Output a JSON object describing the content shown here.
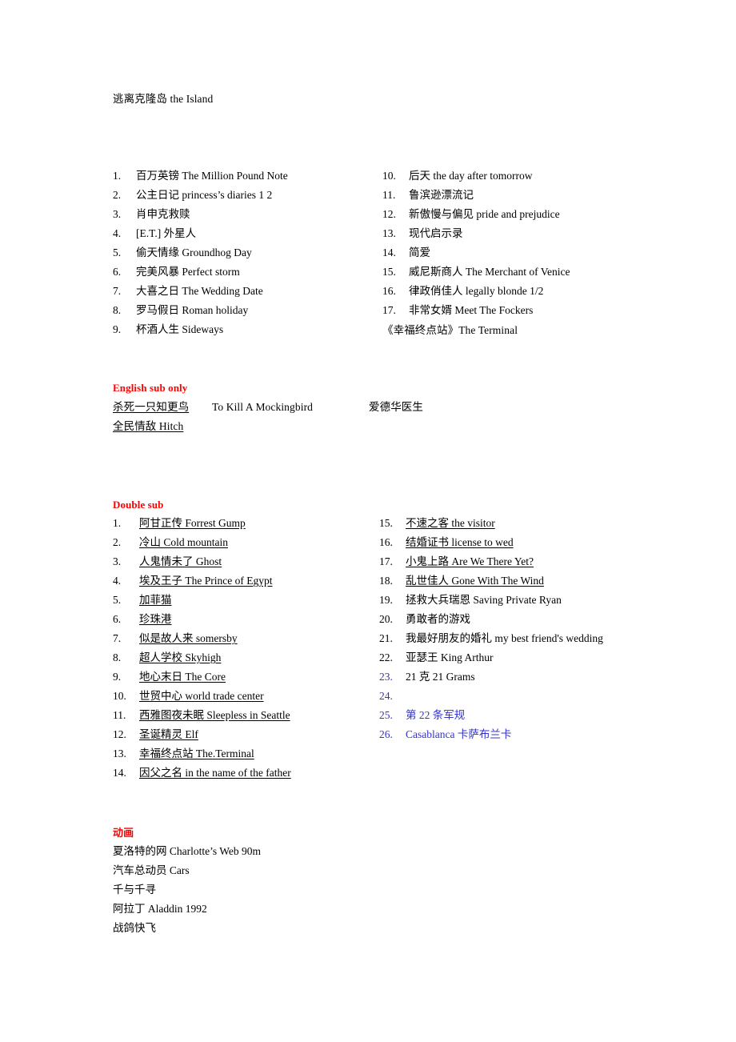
{
  "document": {
    "top_title": "逃离克隆岛  the Island"
  },
  "section_main": {
    "left_items": [
      {
        "num": "1.",
        "text": "百万英镑  The Million Pound Note"
      },
      {
        "num": "2.",
        "text": "公主日记 princess’s diaries 1 2"
      },
      {
        "num": "3.",
        "text": "肖申克救赎"
      },
      {
        "num": "4.",
        "text": "[E.T.]  外星人"
      },
      {
        "num": "5.",
        "text": "偷天情缘 Groundhog Day"
      },
      {
        "num": "6.",
        "text": "完美风暴  Perfect storm"
      },
      {
        "num": "7.",
        "text": "大喜之日 The Wedding Date"
      },
      {
        "num": "8.",
        "text": "罗马假日 Roman holiday"
      },
      {
        "num": "9.",
        "text": "杯酒人生     Sideways"
      }
    ],
    "right_items": [
      {
        "num": "10.",
        "text": "后天  the day after tomorrow"
      },
      {
        "num": "11.",
        "text": "鲁滨逊漂流记"
      },
      {
        "num": "12.",
        "text": "新傲慢与偏见 pride and prejudice"
      },
      {
        "num": "13.",
        "text": "现代启示录"
      },
      {
        "num": "14.",
        "text": "简爱"
      },
      {
        "num": "15.",
        "text": "威尼斯商人 The Merchant of Venice"
      },
      {
        "num": "16.",
        "text": "律政俏佳人  legally blonde 1/2"
      },
      {
        "num": "17.",
        "text": "非常女婿 Meet The Fockers"
      }
    ],
    "right_trailing": "《幸福终点站》The Terminal"
  },
  "section_english_sub": {
    "heading": "English sub only",
    "row1_col1": "杀死一只知更鸟",
    "row1_col2": "To Kill A Mockingbird",
    "row1_col3": "爱德华医生",
    "row2_col1": "全民情敌 Hitch"
  },
  "section_double_sub": {
    "heading": "Double sub",
    "left_items": [
      {
        "num": "1.",
        "text": "阿甘正传 Forrest Gump",
        "underline": true
      },
      {
        "num": "2.",
        "text": "冷山  Cold mountain",
        "underline": true
      },
      {
        "num": "3.",
        "text": "人鬼情未了 Ghost",
        "underline": true
      },
      {
        "num": "4.",
        "text": "埃及王子  The Prince of Egypt",
        "underline": true
      },
      {
        "num": "5.",
        "text": "加菲猫",
        "underline": true
      },
      {
        "num": "6.",
        "text": "珍珠港",
        "underline": true
      },
      {
        "num": "7.",
        "text": "似是故人来  somersby",
        "underline": true
      },
      {
        "num": "8.",
        "text": "超人学校 Skyhigh",
        "underline": true
      },
      {
        "num": "9.",
        "text": "地心末日  The Core",
        "underline": true
      },
      {
        "num": "10.",
        "text": "世贸中心 world trade center",
        "underline": true
      },
      {
        "num": "11.",
        "text": "西雅图夜未眠 Sleepless in Seattle ",
        "underline": true
      },
      {
        "num": "12.",
        "text": "圣诞精灵 Elf",
        "underline": true
      },
      {
        "num": "13.",
        "text": "幸福终点站 The.Terminal",
        "underline": true
      },
      {
        "num": "14.",
        "text": "因父之名 in the name of the father",
        "underline": true
      }
    ],
    "right_items": [
      {
        "num": "15.",
        "text": "不速之客 the visitor",
        "underline": true,
        "color": "black"
      },
      {
        "num": "16.",
        "text": "结婚证书 license to wed",
        "underline": true,
        "color": "black"
      },
      {
        "num": "17.",
        "text": "小鬼上路 Are We There Yet?",
        "underline": true,
        "color": "black"
      },
      {
        "num": "18.",
        "text": "乱世佳人 Gone With The Wind  ",
        "underline": true,
        "color": "black"
      },
      {
        "num": "19.",
        "text": "拯救大兵瑞恩 Saving Private Ryan",
        "underline": false,
        "color": "black"
      },
      {
        "num": "20.",
        "text": "勇敢者的游戏",
        "underline": false,
        "color": "black"
      },
      {
        "num": "21.",
        "text": "我最好朋友的婚礼 my best friend's wedding",
        "underline": false,
        "color": "black"
      },
      {
        "num": "22.",
        "text": "亚瑟王 King Arthur",
        "underline": false,
        "color": "black"
      },
      {
        "num": "23.",
        "text": "21 克  21 Grams",
        "underline": false,
        "color": "black",
        "num_color": "blue"
      },
      {
        "num": "24.",
        "text": "",
        "underline": false,
        "color": "blue",
        "num_color": "blue"
      },
      {
        "num": "25.",
        "text": "第 22 条军规",
        "underline": false,
        "color": "blue",
        "num_color": "blue"
      },
      {
        "num": "26.",
        "text": "Casablanca  卡萨布兰卡",
        "underline": false,
        "color": "blue",
        "num_color": "blue"
      }
    ]
  },
  "section_animation": {
    "heading": "动画",
    "items": [
      "夏洛特的网 Charlotte’s Web 90m",
      "汽车总动员  Cars",
      "千与千寻",
      "阿拉丁  Aladdin 1992",
      "战鸽快飞"
    ]
  },
  "colors": {
    "heading_red": "#ff0000",
    "blue_item": "#3333cc",
    "text_black": "#000000",
    "page_background": "#ffffff"
  }
}
